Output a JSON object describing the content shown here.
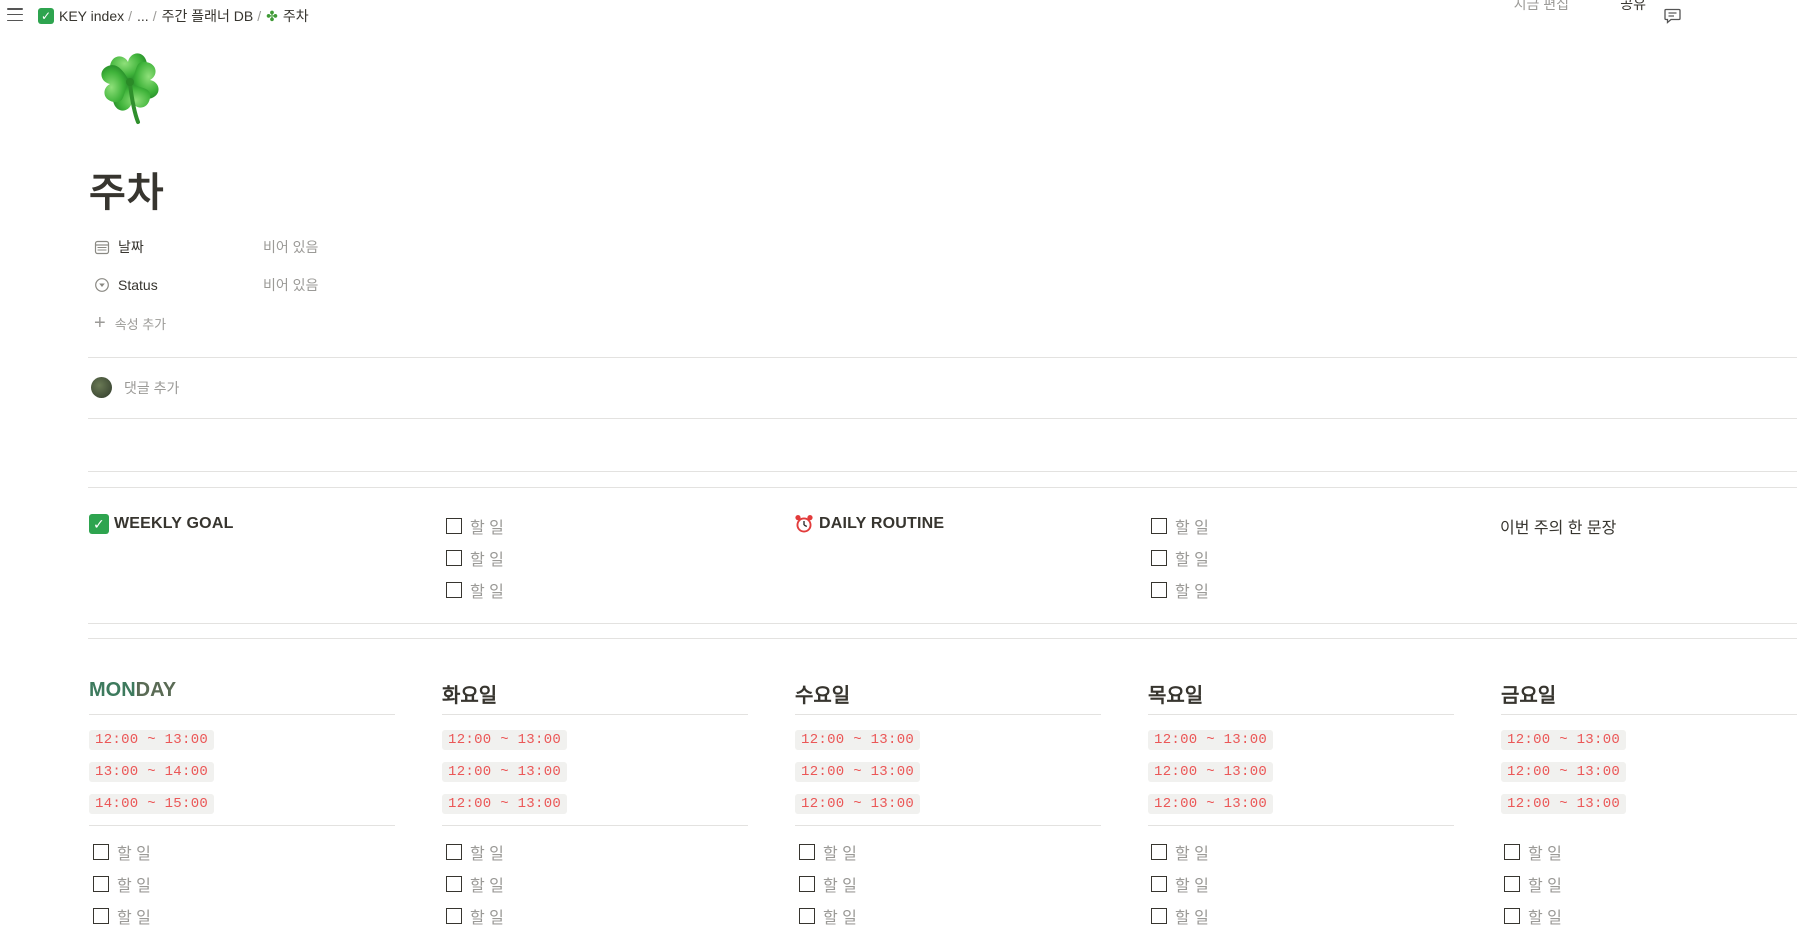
{
  "breadcrumb": {
    "items": [
      "KEY index",
      "...",
      "주간 플래너 DB",
      "주차"
    ]
  },
  "topbar": {
    "edited": "지금 편집",
    "share": "공유"
  },
  "page": {
    "title": "주차"
  },
  "properties": [
    {
      "name": "날짜",
      "value": "비어 있음",
      "icon": "calendar-icon"
    },
    {
      "name": "Status",
      "value": "비어 있음",
      "icon": "status-icon"
    }
  ],
  "add_property": "속성 추가",
  "add_comment": "댓글 추가",
  "weekly_goal": {
    "title": "WEEKLY GOAL",
    "todos": [
      "할 일",
      "할 일",
      "할 일"
    ]
  },
  "daily_routine": {
    "title": "DAILY ROUTINE",
    "todos": [
      "할 일",
      "할 일",
      "할 일"
    ]
  },
  "sentence": "이번 주의 한 문장",
  "days": [
    {
      "name_a": "MON",
      "name_b": "DAY",
      "times": [
        "12:00 ~ 13:00",
        "13:00 ~ 14:00",
        "14:00 ~ 15:00"
      ],
      "todos": [
        "할 일",
        "할 일",
        "할 일"
      ]
    },
    {
      "name": "화요일",
      "times": [
        "12:00 ~ 13:00",
        "12:00 ~ 13:00",
        "12:00 ~ 13:00"
      ],
      "todos": [
        "할 일",
        "할 일",
        "할 일"
      ]
    },
    {
      "name": "수요일",
      "times": [
        "12:00 ~ 13:00",
        "12:00 ~ 13:00",
        "12:00 ~ 13:00"
      ],
      "todos": [
        "할 일",
        "할 일",
        "할 일"
      ]
    },
    {
      "name": "목요일",
      "times": [
        "12:00 ~ 13:00",
        "12:00 ~ 13:00",
        "12:00 ~ 13:00"
      ],
      "todos": [
        "할 일",
        "할 일",
        "할 일"
      ]
    },
    {
      "name": "금요일",
      "times": [
        "12:00 ~ 13:00",
        "12:00 ~ 13:00",
        "12:00 ~ 13:00"
      ],
      "todos": [
        "할 일",
        "할 일",
        "할 일"
      ]
    }
  ],
  "colors": {
    "time_text": "#eb5757",
    "time_bg": "#f1f1ef",
    "monday_accent": "#3d7a5d",
    "muted": "#9b9a97"
  }
}
